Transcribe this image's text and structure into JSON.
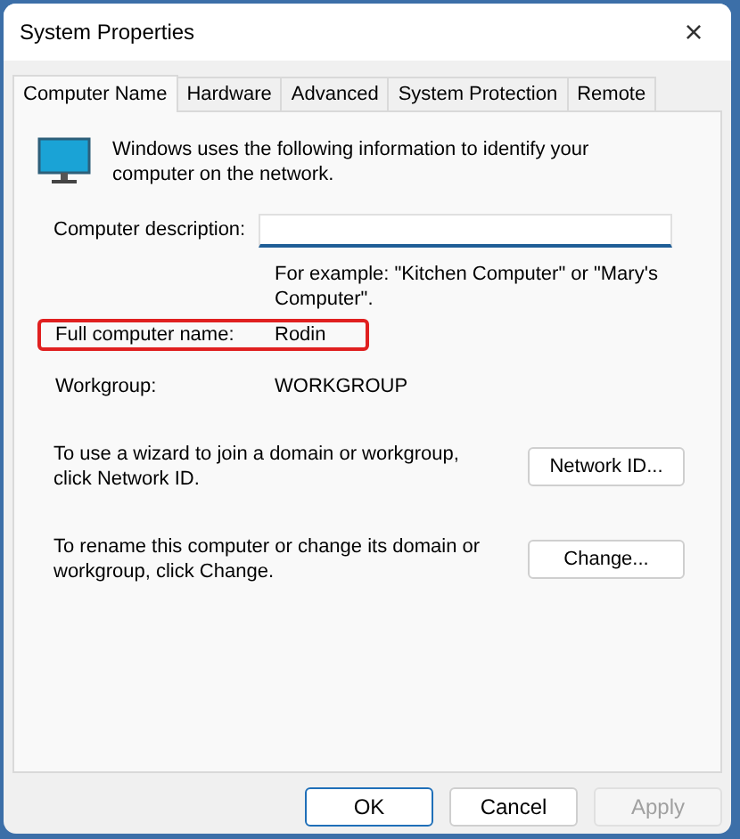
{
  "window": {
    "title": "System Properties",
    "close": "×"
  },
  "tabs": [
    {
      "label": "Computer Name",
      "selected": true
    },
    {
      "label": "Hardware",
      "selected": false
    },
    {
      "label": "Advanced",
      "selected": false
    },
    {
      "label": "System Protection",
      "selected": false
    },
    {
      "label": "Remote",
      "selected": false
    }
  ],
  "intro": "Windows uses the following information to identify your computer on the network.",
  "description_field": {
    "label": "Computer description:",
    "hint": "For example: \"Kitchen Computer\" or \"Mary's Computer\"."
  },
  "info_rows": [
    {
      "label": "Full computer name:",
      "value": "Rodin",
      "highlighted": true
    },
    {
      "label": "Workgroup:",
      "value": "WORKGROUP",
      "highlighted": false
    }
  ],
  "actions": [
    {
      "text": "To use a wizard to join a domain or workgroup, click Network ID.",
      "button": "Network ID..."
    },
    {
      "text": "To rename this computer or change its domain or workgroup, click Change.",
      "button": "Change..."
    }
  ],
  "buttons": [
    {
      "label": "OK",
      "kind": "default",
      "disabled": false
    },
    {
      "label": "Cancel",
      "kind": "normal",
      "disabled": false
    },
    {
      "label": "Apply",
      "kind": "normal",
      "disabled": true
    }
  ]
}
